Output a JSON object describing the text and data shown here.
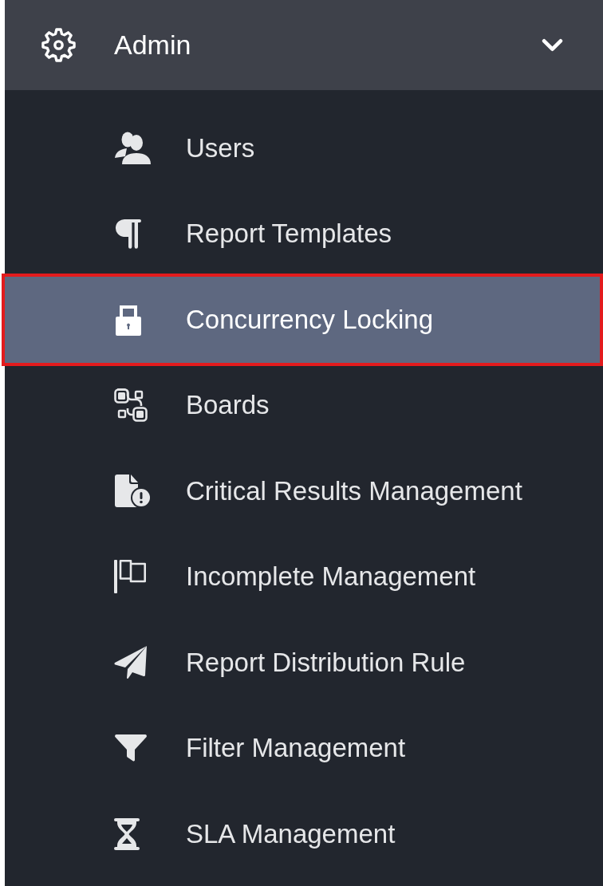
{
  "menu": {
    "title": "Admin",
    "expanded": true,
    "items": [
      {
        "label": "Users",
        "selected": false
      },
      {
        "label": "Report Templates",
        "selected": false
      },
      {
        "label": "Concurrency Locking",
        "selected": true
      },
      {
        "label": "Boards",
        "selected": false
      },
      {
        "label": "Critical Results Management",
        "selected": false
      },
      {
        "label": "Incomplete Management",
        "selected": false
      },
      {
        "label": "Report Distribution Rule",
        "selected": false
      },
      {
        "label": "Filter Management",
        "selected": false
      },
      {
        "label": "SLA Management",
        "selected": false
      }
    ]
  }
}
